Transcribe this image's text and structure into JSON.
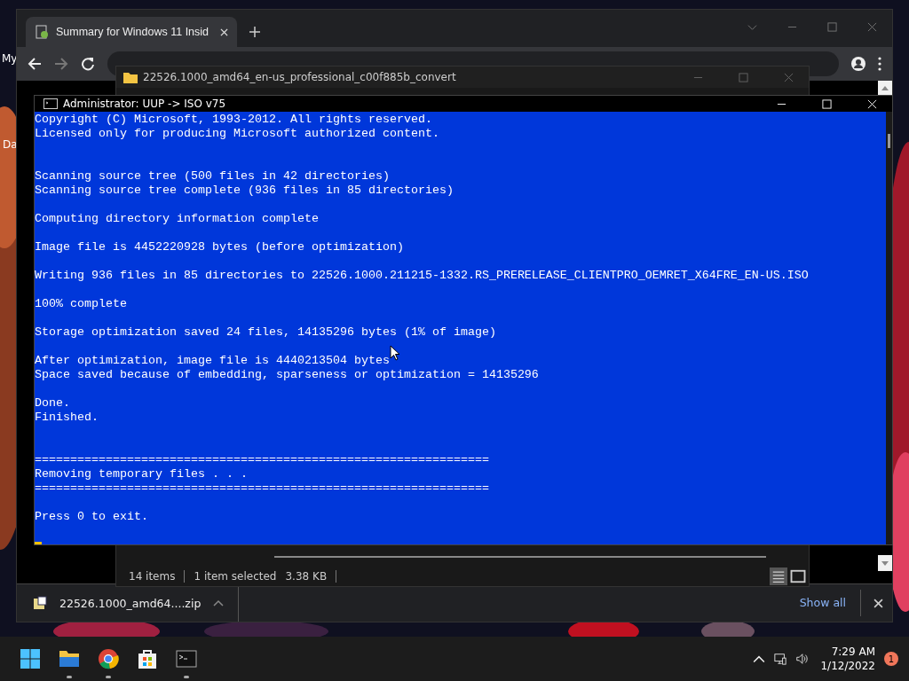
{
  "desktop": {
    "labels": [
      "My",
      "Da"
    ]
  },
  "browser": {
    "tab": {
      "title": "Summary for Windows 11 Insid",
      "selected": true
    }
  },
  "explorer": {
    "title": "22526.1000_amd64_en-us_professional_c00f885b_convert",
    "status": [
      "14 items",
      "1 item selected",
      "3.38 KB"
    ]
  },
  "console": {
    "title": "Administrator:  UUP -> ISO v75",
    "blocks": [
      {
        "extra_break": false,
        "lines": [
          "Copyright (C) Microsoft, 1993-2012. All rights reserved.",
          "Licensed only for producing Microsoft authorized content."
        ]
      },
      {
        "extra_break": true,
        "lines": [
          "Scanning source tree (500 files in 42 directories)",
          "Scanning source tree complete (936 files in 85 directories)"
        ]
      },
      {
        "extra_break": false,
        "lines": [
          "Computing directory information complete"
        ]
      },
      {
        "extra_break": false,
        "lines": [
          "Image file is 4452220928 bytes (before optimization)"
        ]
      },
      {
        "extra_break": false,
        "lines": [
          "Writing 936 files in 85 directories to 22526.1000.211215-1332.RS_PRERELEASE_CLIENTPRO_OEMRET_X64FRE_EN-US.ISO"
        ]
      },
      {
        "extra_break": false,
        "lines": [
          "100% complete"
        ]
      },
      {
        "extra_break": false,
        "lines": [
          "Storage optimization saved 24 files, 14135296 bytes (1% of image)"
        ]
      },
      {
        "extra_break": false,
        "lines": [
          "After optimization, image file is 4440213504 bytes",
          "Space saved because of embedding, sparseness or optimization = 14135296"
        ]
      },
      {
        "extra_break": false,
        "lines": [
          "Done.",
          "Finished."
        ]
      },
      {
        "extra_break": true,
        "lines": [
          "================================================================",
          "Removing temporary files . . .",
          "================================================================"
        ]
      },
      {
        "extra_break": false,
        "lines": [
          "Press 0 to exit."
        ]
      }
    ]
  },
  "download_bar": {
    "file": "22526.1000_amd64....zip",
    "show_all": "Show all"
  },
  "taskbar": {
    "apps": [
      {
        "kind": "start",
        "running": false
      },
      {
        "kind": "explorer",
        "running": true
      },
      {
        "kind": "chrome",
        "running": true
      },
      {
        "kind": "store",
        "running": false
      },
      {
        "kind": "terminal",
        "running": true
      }
    ],
    "time": "7:29 AM",
    "date": "1/12/2022",
    "notifications": "1"
  }
}
